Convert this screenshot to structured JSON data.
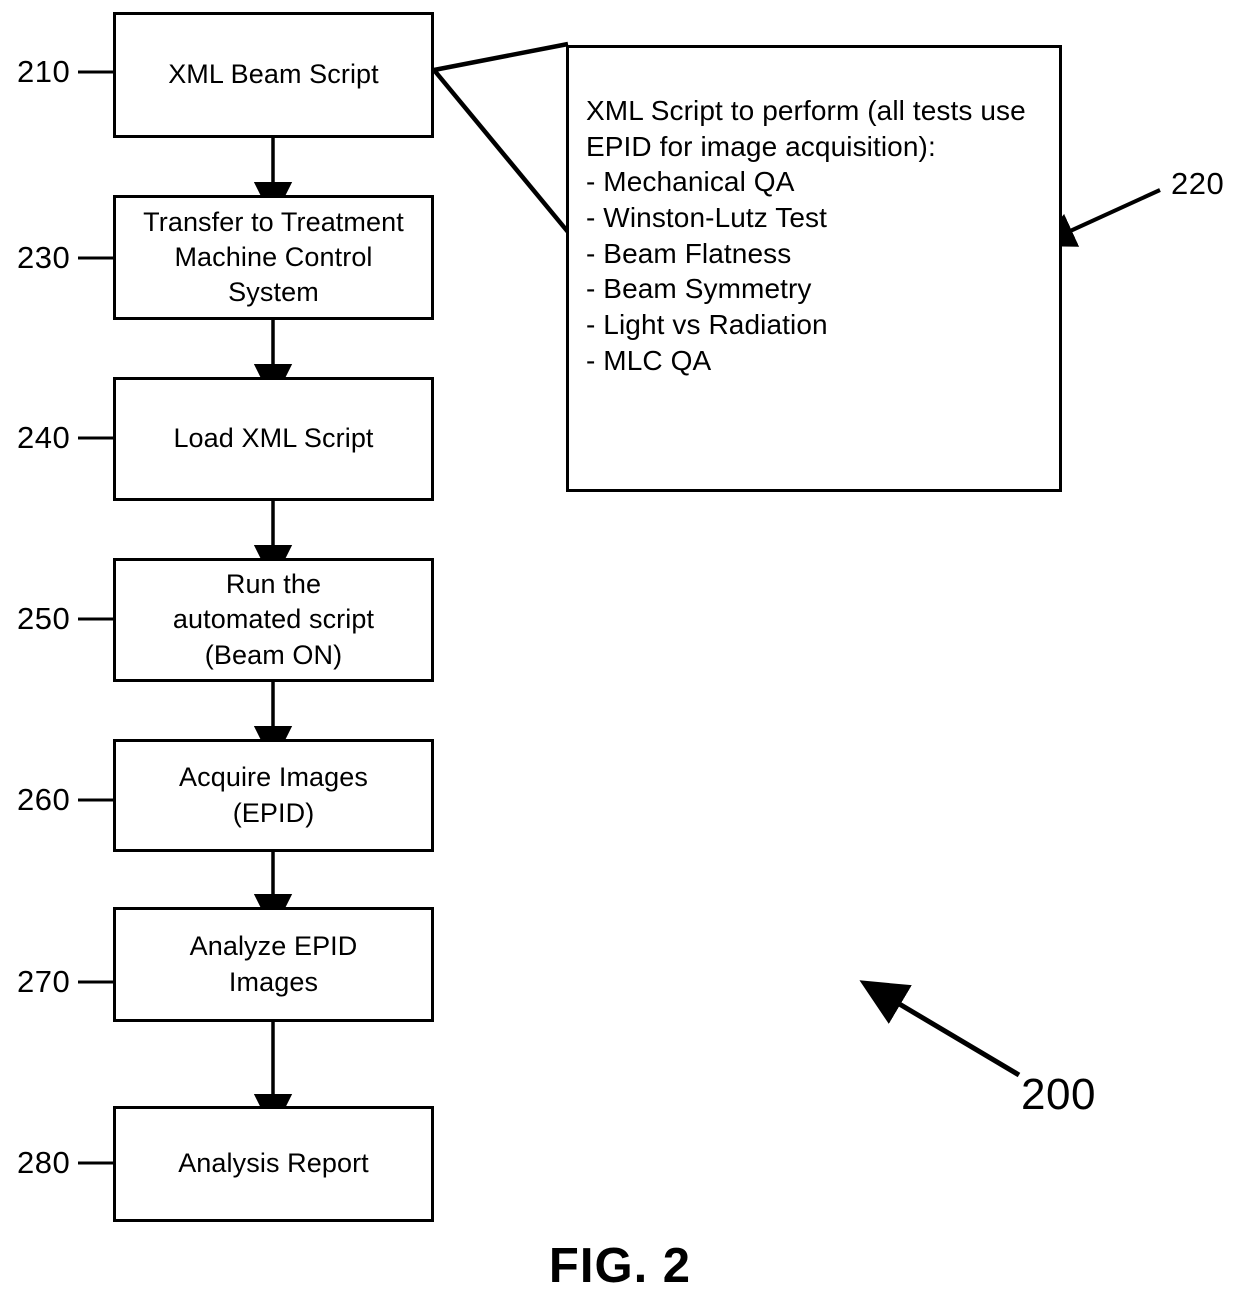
{
  "figure": {
    "caption": "FIG. 2",
    "diagram_ref": "200",
    "callout_ref": "220"
  },
  "flow": {
    "nodes": [
      {
        "ref": "210",
        "label": "XML Beam Script"
      },
      {
        "ref": "230",
        "label": "Transfer to Treatment\nMachine Control\nSystem"
      },
      {
        "ref": "240",
        "label": "Load XML Script"
      },
      {
        "ref": "250",
        "label": "Run the\nautomated script\n(Beam ON)"
      },
      {
        "ref": "260",
        "label": "Acquire Images\n(EPID)"
      },
      {
        "ref": "270",
        "label": "Analyze EPID\nImages"
      },
      {
        "ref": "280",
        "label": "Analysis Report"
      }
    ]
  },
  "callout": {
    "heading": "XML Script to perform (all tests use EPID for image acquisition):",
    "items": [
      "- Mechanical QA",
      "- Winston-Lutz Test",
      "- Beam Flatness",
      "- Beam Symmetry",
      "- Light vs Radiation",
      "- MLC QA"
    ],
    "text": "XML Script to perform (all tests use EPID for image acquisition):\n- Mechanical QA\n- Winston-Lutz Test\n- Beam Flatness\n- Beam Symmetry\n- Light vs Radiation\n- MLC QA"
  },
  "colors": {
    "stroke": "#000000",
    "fill": "#ffffff"
  }
}
